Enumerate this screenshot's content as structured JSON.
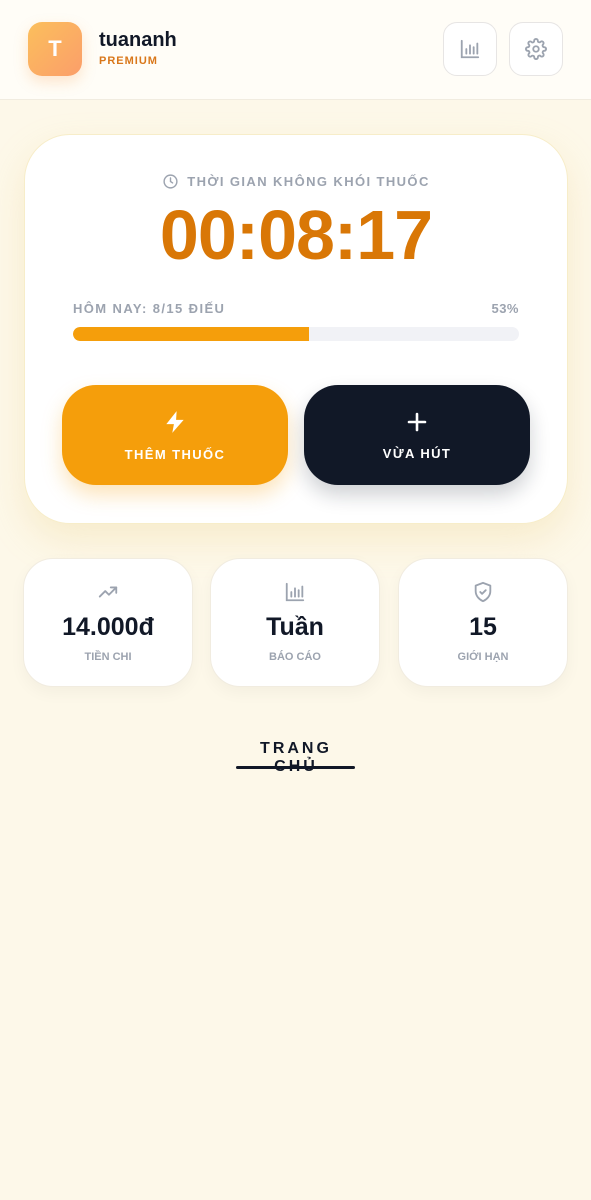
{
  "user": {
    "initial": "T",
    "name": "tuananh",
    "tier": "PREMIUM"
  },
  "header": {
    "stats_icon": "bar-chart-icon",
    "settings_icon": "gear-icon"
  },
  "timer": {
    "caption": "THỜI GIAN KHÔNG KHÓI THUỐC",
    "value": "00:08:17",
    "today_label": "HÔM NAY: 8/15 ĐIẾU",
    "today_percent": "53%",
    "progress": 0.53
  },
  "actions": {
    "add_label": "THÊM THUỐC",
    "add_icon": "lightning-icon",
    "smoked_label": "VỪA HÚT",
    "smoked_icon": "plus-icon"
  },
  "stats": [
    {
      "icon": "trending-up-icon",
      "value": "14.000đ",
      "label": "TIỀN CHI"
    },
    {
      "icon": "bar-chart-icon",
      "value": "Tuần",
      "label": "BÁO CÁO"
    },
    {
      "icon": "shield-check-icon",
      "value": "15",
      "label": "GIỚI HẠN"
    }
  ],
  "nav": {
    "home_label": "TRANG CHỦ"
  },
  "colors": {
    "accent": "#f59e0b",
    "timer": "#d97706",
    "dark": "#111827",
    "background": "#fdf8e9"
  }
}
